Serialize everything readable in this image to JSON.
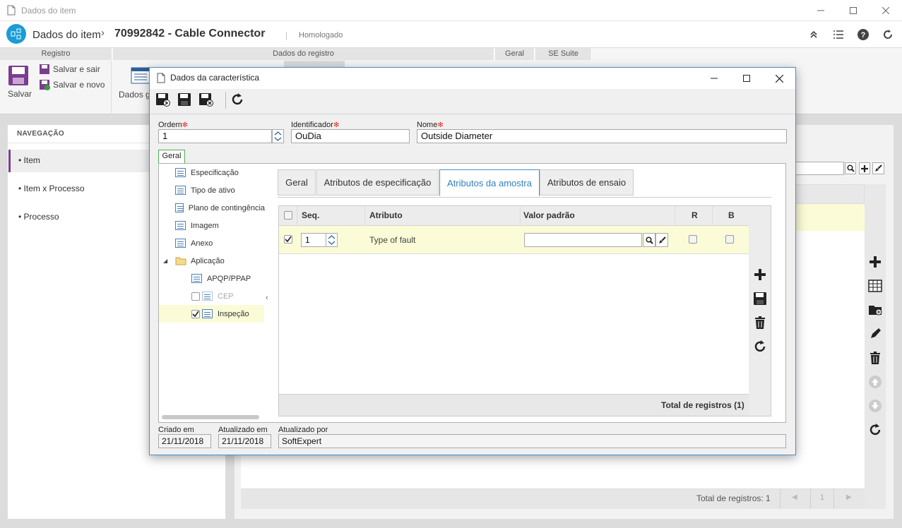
{
  "window": {
    "title": "Dados do item"
  },
  "header": {
    "app_title": "Dados do item",
    "separator": "›",
    "item_title": "70992842 - Cable Connector",
    "divider": "|",
    "status": "Homologado"
  },
  "ribbon": {
    "groups": [
      "Registro",
      "Dados do registro",
      "Geral",
      "SE Suite"
    ],
    "save_label": "Salvar",
    "save_exit_label": "Salvar e sair",
    "save_new_label": "Salvar e novo",
    "general_data_label": "Dados ge"
  },
  "navigation": {
    "title": "NAVEGAÇÃO",
    "items": [
      {
        "label": "Item",
        "active": true
      },
      {
        "label": "Item x Processo",
        "active": false
      },
      {
        "label": "Processo",
        "active": false
      }
    ]
  },
  "main_footer": {
    "total": "Total de registros: 1",
    "page": "1"
  },
  "dialog": {
    "title": "Dados da característica",
    "ordem_label": "Ordem",
    "ordem_value": "1",
    "identificador_label": "Identificador",
    "identificador_value": "OuDia",
    "nome_label": "Nome",
    "nome_value": "Outside Diameter",
    "group_tab": "Geral",
    "tree": [
      {
        "label": "Especificação"
      },
      {
        "label": "Tipo de ativo"
      },
      {
        "label": "Plano de contingência"
      },
      {
        "label": "Imagem"
      },
      {
        "label": "Anexo"
      },
      {
        "label": "Aplicação"
      },
      {
        "label": "APQP/PPAP"
      },
      {
        "label": "CEP"
      },
      {
        "label": "Inspeção"
      }
    ],
    "tabs": [
      "Geral",
      "Atributos de especificação",
      "Atributos da amostra",
      "Atributos de ensaio"
    ],
    "selected_tab": "Atributos da amostra",
    "grid": {
      "columns": [
        "Seq.",
        "Atributo",
        "Valor padrão",
        "R",
        "B"
      ],
      "rows": [
        {
          "seq": "1",
          "atributo": "Type of fault",
          "valor": "",
          "r": false,
          "b": false,
          "checked": true
        }
      ],
      "total": "Total de registros (1)"
    },
    "footer": {
      "criado_label": "Criado em",
      "criado_value": "21/11/2018",
      "atualizado_label": "Atualizado em",
      "atualizado_value": "21/11/2018",
      "atualizado_por_label": "Atualizado por",
      "atualizado_por_value": "SoftExpert"
    }
  },
  "colors": {
    "accent": "#2f7fc1",
    "nav_active": "#7b3d8f",
    "highlight_row": "#fbfbd8",
    "required": "#e0302a",
    "logo": "#1a9cd6"
  }
}
